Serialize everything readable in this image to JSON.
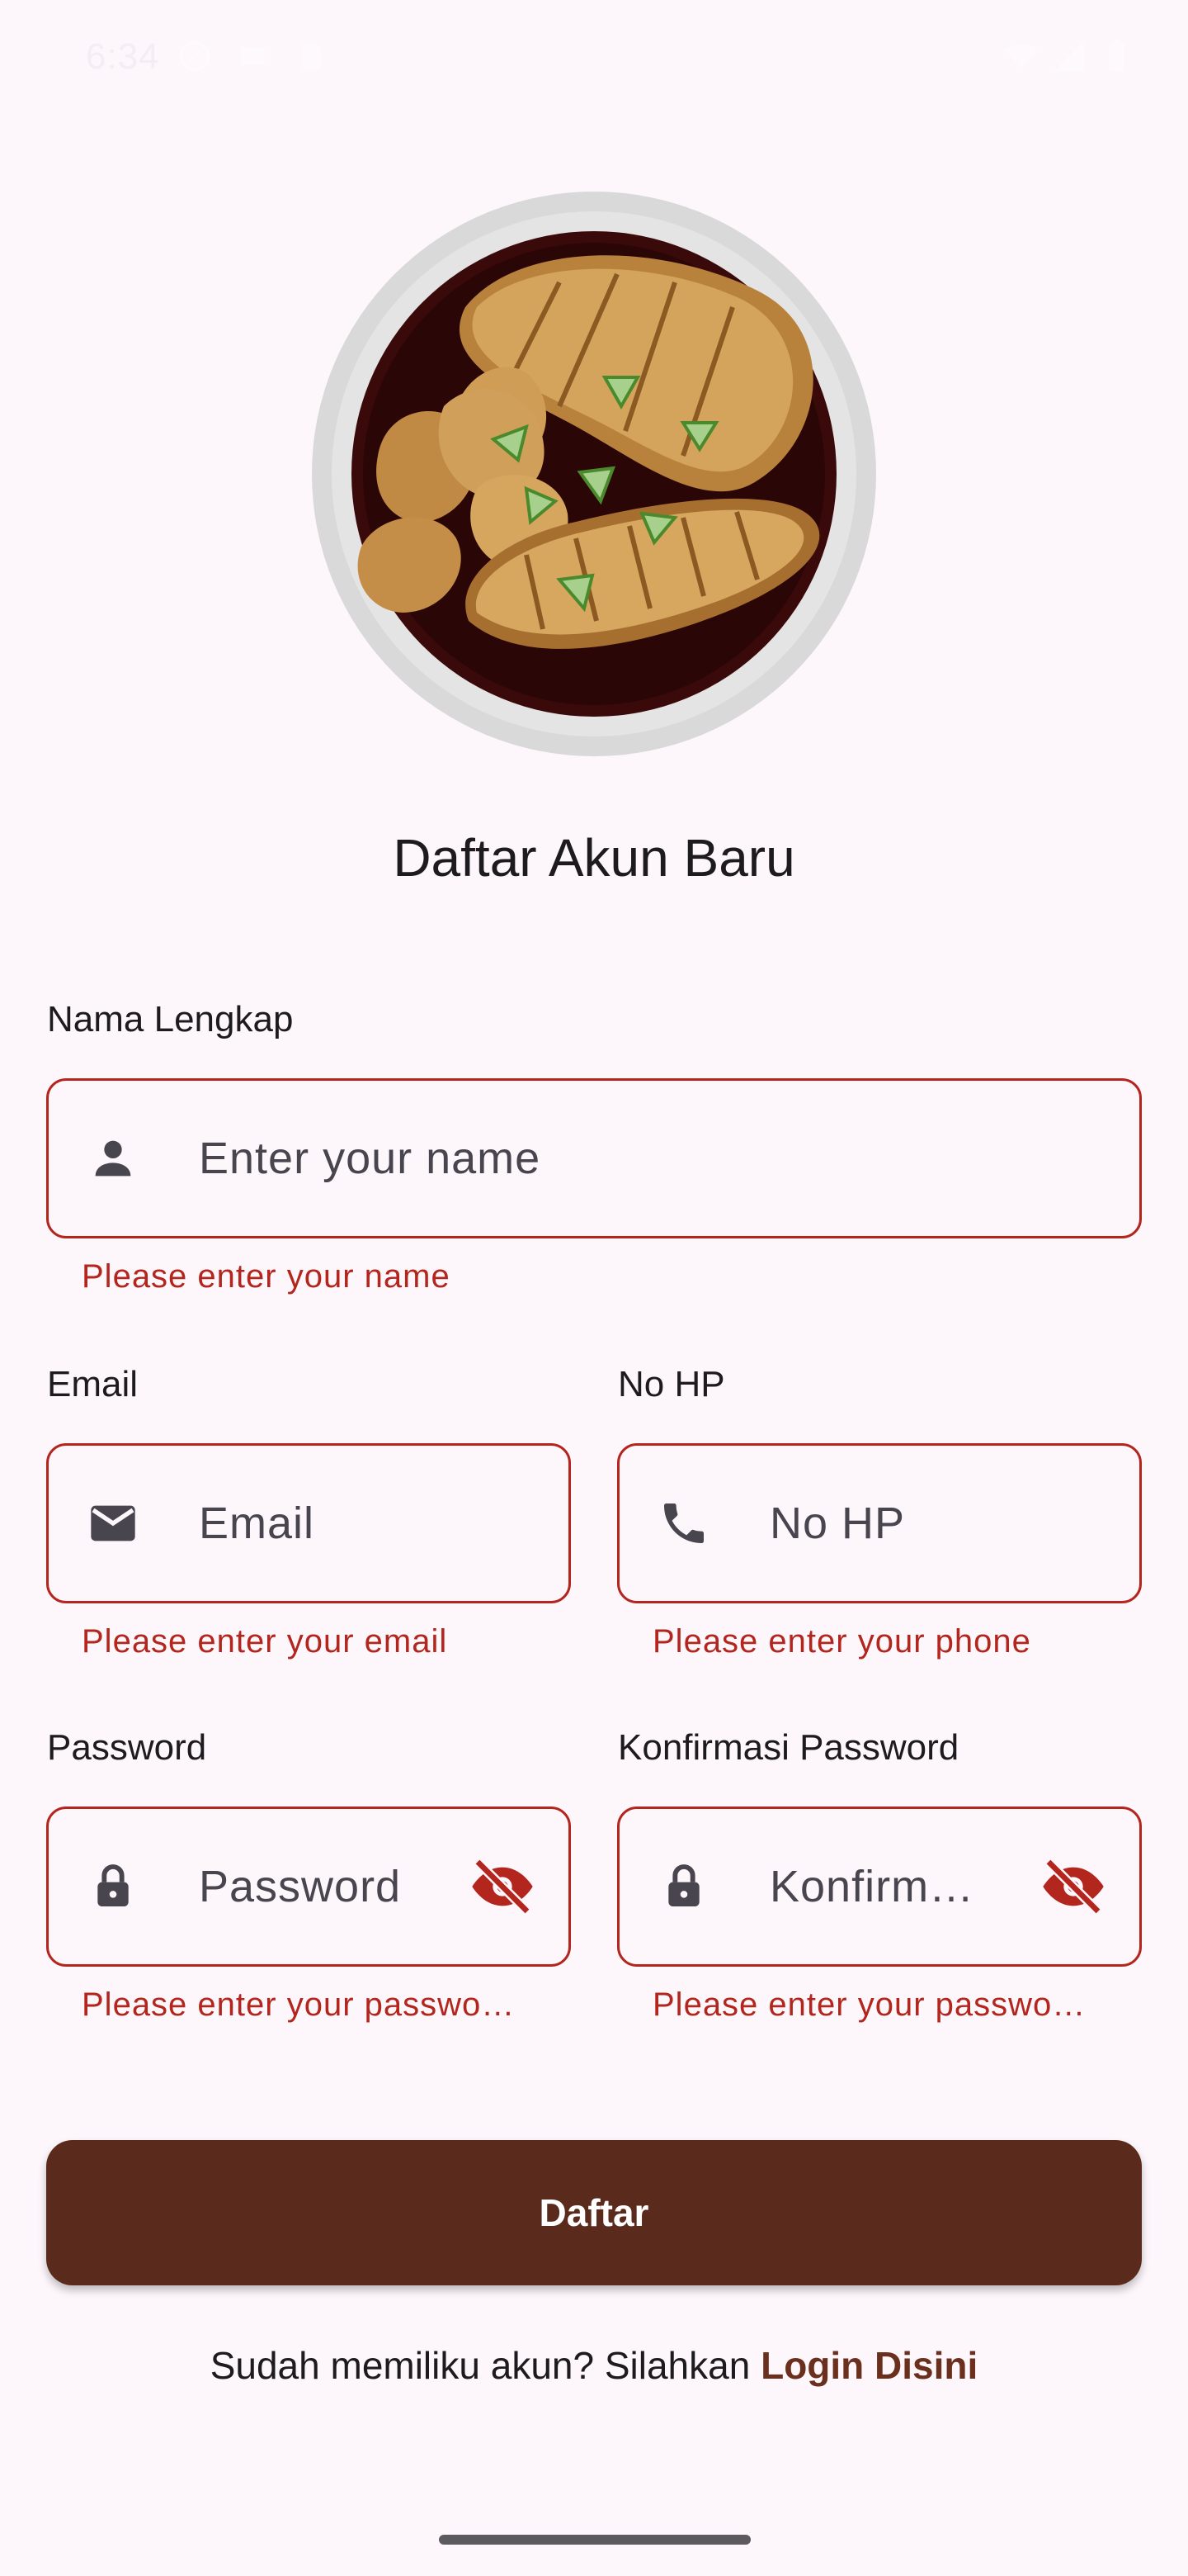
{
  "status_bar": {
    "time": "6:34"
  },
  "page": {
    "title": "Daftar Akun Baru"
  },
  "fields": {
    "name": {
      "label": "Nama Lengkap",
      "placeholder": "Enter your name",
      "error": "Please enter your name",
      "icon": "person-icon"
    },
    "email": {
      "label": "Email",
      "placeholder": "Email",
      "error": "Please enter your email",
      "icon": "mail-icon"
    },
    "phone": {
      "label": "No HP",
      "placeholder": "No HP",
      "error": "Please enter your phone",
      "icon": "phone-icon"
    },
    "password": {
      "label": "Password",
      "placeholder": "Password",
      "error": "Please enter your passwo…",
      "icon": "lock-icon",
      "toggle_icon": "visibility-off-icon"
    },
    "confirm_password": {
      "label": "Konfirmasi Password",
      "placeholder": "Konfirm…",
      "error": "Please enter your passwo…",
      "icon": "lock-icon",
      "toggle_icon": "visibility-off-icon"
    }
  },
  "actions": {
    "register_label": "Daftar",
    "login_prompt": "Sudah memiliku akun? Silahkan",
    "login_link": "Login Disini"
  },
  "colors": {
    "error": "#b3261e",
    "primary_button": "#5a2a1c",
    "link": "#6b2f1d",
    "background": "#fdf7fc"
  }
}
